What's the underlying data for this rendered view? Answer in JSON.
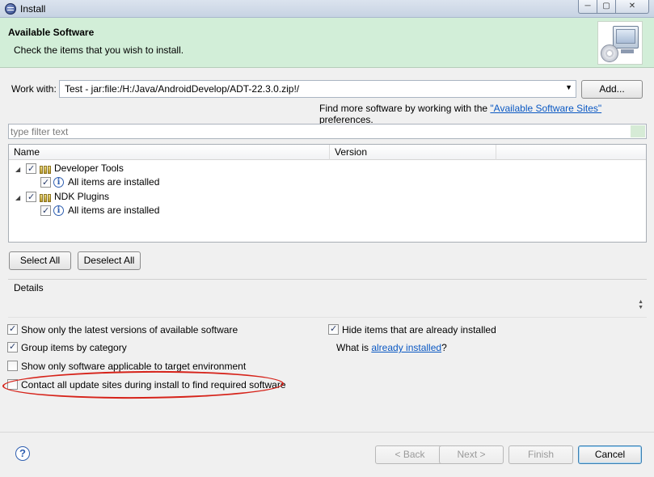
{
  "window": {
    "title": "Install",
    "controls": {
      "minimize": "─",
      "maximize": "▢",
      "close": "✕"
    }
  },
  "header": {
    "title": "Available Software",
    "description": "Check the items that you wish to install."
  },
  "work_with": {
    "label": "Work with:",
    "value": "Test - jar:file:/H:/Java/AndroidDevelop/ADT-22.3.0.zip!/",
    "add_button": "Add...",
    "find_more_prefix": "Find more software by working with the ",
    "find_more_link": "\"Available Software Sites\"",
    "find_more_suffix": " preferences."
  },
  "filter": {
    "placeholder": "type filter text"
  },
  "tree": {
    "columns": [
      "Name",
      "Version"
    ],
    "items": [
      {
        "label": "Developer Tools",
        "checked": true,
        "children": [
          {
            "label": "All items are installed",
            "checked": true
          }
        ]
      },
      {
        "label": "NDK Plugins",
        "checked": true,
        "children": [
          {
            "label": "All items are installed",
            "checked": true
          }
        ]
      }
    ]
  },
  "selection_buttons": {
    "select_all": "Select All",
    "deselect_all": "Deselect All"
  },
  "details": {
    "label": "Details"
  },
  "options": {
    "show_latest": {
      "label": "Show only the latest versions of available software",
      "checked": true
    },
    "group_by_category": {
      "label": "Group items by category",
      "checked": true
    },
    "show_applicable": {
      "label": "Show only software applicable to target environment",
      "checked": false
    },
    "contact_update_sites": {
      "label": "Contact all update sites during install to find required software",
      "checked": false
    },
    "hide_installed": {
      "label": "Hide items that are already installed",
      "checked": true
    },
    "what_is_prefix": "What is ",
    "what_is_link": "already installed",
    "what_is_suffix": "?"
  },
  "footer": {
    "back": "< Back",
    "next": "Next >",
    "finish": "Finish",
    "cancel": "Cancel"
  },
  "colors": {
    "header_bg": "#d2eed8",
    "link": "#0a58c3",
    "annotation": "#d6231a"
  }
}
